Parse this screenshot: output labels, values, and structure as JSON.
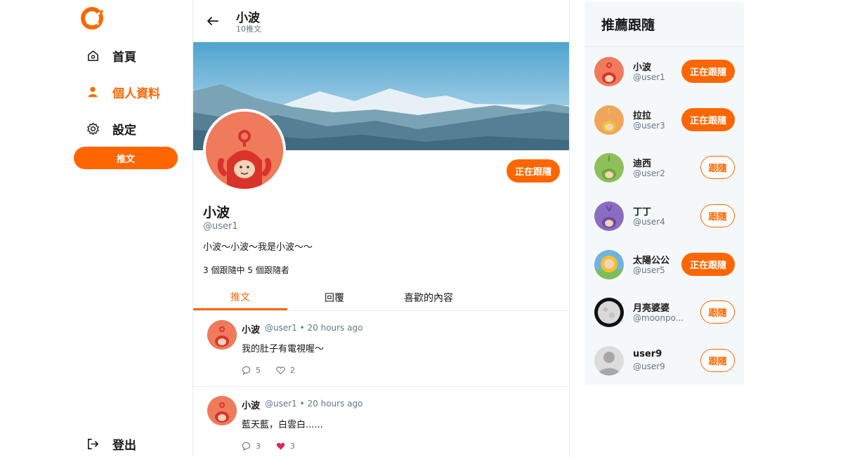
{
  "nav": {
    "items": [
      {
        "label": "首頁",
        "icon": "home-icon"
      },
      {
        "label": "個人資料",
        "icon": "user-icon"
      },
      {
        "label": "設定",
        "icon": "gear-icon"
      }
    ],
    "tweet_button": "推文",
    "logout": "登出"
  },
  "header": {
    "name": "小波",
    "count": "10推文"
  },
  "profile": {
    "name": "小波",
    "handle": "@user1",
    "bio": "小波～小波～我是小波～～",
    "stats": "3 個跟隨中 5 個跟隨者",
    "follow_button": "正在跟隨"
  },
  "tabs": [
    "推文",
    "回覆",
    "喜歡的內容"
  ],
  "tweets": [
    {
      "name": "小波",
      "meta": "@user1 • 20 hours ago",
      "text": "我的肚子有電視喔～",
      "replies": "5",
      "likes": "2",
      "liked": false
    },
    {
      "name": "小波",
      "meta": "@user1 • 20 hours ago",
      "text": "藍天藍，白雲白......",
      "replies": "3",
      "likes": "3",
      "liked": true
    }
  ],
  "recommend": {
    "title": "推薦跟隨",
    "users": [
      {
        "name": "小波",
        "handle": "@user1",
        "button": "正在跟隨",
        "following": true
      },
      {
        "name": "拉拉",
        "handle": "@user3",
        "button": "正在跟隨",
        "following": true
      },
      {
        "name": "迪西",
        "handle": "@user2",
        "button": "跟隨",
        "following": false
      },
      {
        "name": "丁丁",
        "handle": "@user4",
        "button": "跟隨",
        "following": false
      },
      {
        "name": "太陽公公",
        "handle": "@user5",
        "button": "正在跟隨",
        "following": true
      },
      {
        "name": "月亮婆婆",
        "handle": "@moonpo...",
        "button": "跟隨",
        "following": false
      },
      {
        "name": "user9",
        "handle": "@user9",
        "button": "跟隨",
        "following": false
      }
    ]
  },
  "colors": {
    "accent": "#ff6600",
    "muted": "#657786",
    "border": "#e6ecf0",
    "panel": "#f5f8fa",
    "like": "#e0245e"
  }
}
